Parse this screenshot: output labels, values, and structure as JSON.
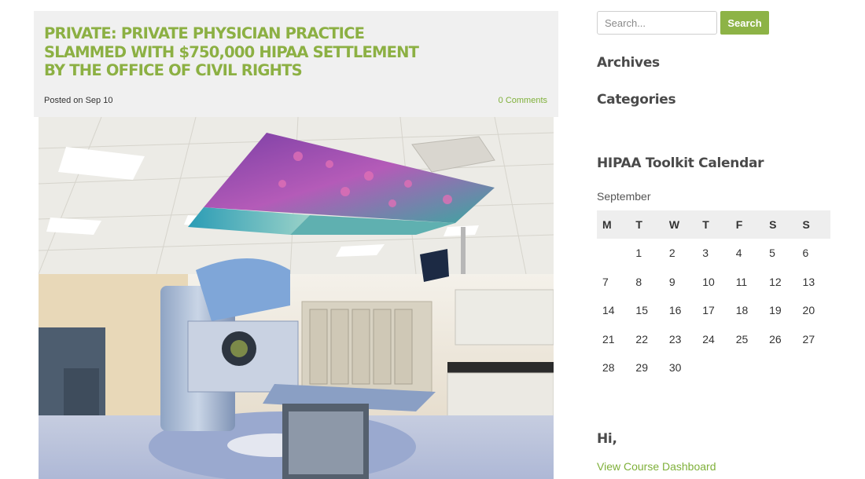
{
  "post": {
    "title": "PRIVATE: PRIVATE PHYSICIAN PRACTICE SLAMMED WITH $750,000 HIPAA SETTLEMENT BY THE OFFICE OF CIVIL RIGHTS",
    "posted_on": "Posted on Sep 10",
    "comments": "0 Comments"
  },
  "sidebar": {
    "search": {
      "placeholder": "Search...",
      "value": "",
      "button_label": "Search"
    },
    "archives_title": "Archives",
    "categories_title": "Categories",
    "calendar": {
      "title": "HIPAA Toolkit Calendar",
      "month": "September",
      "weekdays": [
        "M",
        "T",
        "W",
        "T",
        "F",
        "S",
        "S"
      ],
      "weeks": [
        [
          "",
          "1",
          "2",
          "3",
          "4",
          "5",
          "6"
        ],
        [
          "7",
          "8",
          "9",
          "10",
          "11",
          "12",
          "13"
        ],
        [
          "14",
          "15",
          "16",
          "17",
          "18",
          "19",
          "20"
        ],
        [
          "21",
          "22",
          "23",
          "24",
          "25",
          "26",
          "27"
        ],
        [
          "28",
          "29",
          "30",
          "",
          "",
          "",
          ""
        ]
      ]
    },
    "greeting": "Hi,",
    "dashboard_link": "View Course Dashboard"
  },
  "colors": {
    "accent": "#8cb043",
    "button": "#8db346",
    "link": "#7fb03a",
    "header_bg": "#f0f0f0"
  }
}
